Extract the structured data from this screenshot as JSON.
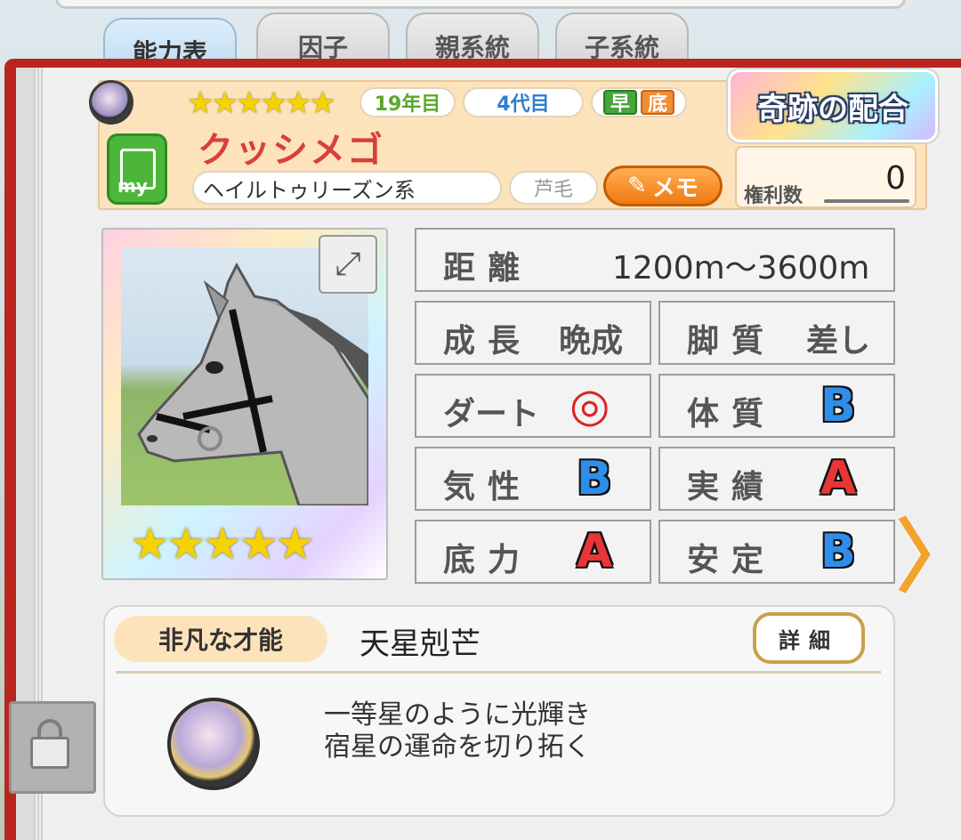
{
  "tabs": [
    "能力表",
    "因子",
    "親系統",
    "子系統"
  ],
  "header": {
    "star_glyphs": "★★★★★★",
    "generation_years": "19年目",
    "generation_count": "4代目",
    "aptitude_early": "早",
    "aptitude_base": "底",
    "horse_name": "クッシメゴ",
    "my_badge": "my",
    "lineage": "ヘイルトゥリーズン系",
    "coat": "芦毛",
    "memo_label": "メモ",
    "miracle_label": "奇跡の配合",
    "rights_label": "権利数",
    "rights_value": "0"
  },
  "portrait": {
    "star_glyphs": "★★★★★",
    "expand_glyph": "⤢"
  },
  "stats": {
    "distance_label": "距離",
    "distance_value": "1200m〜3600m",
    "growth_label": "成長",
    "growth_value": "晩成",
    "leg_label": "脚質",
    "leg_value": "差し",
    "dirt_label": "ダート",
    "dirt_value": "◎",
    "constitution_label": "体質",
    "constitution_value": "B",
    "temper_label": "気性",
    "temper_value": "B",
    "record_label": "実績",
    "record_value": "A",
    "stamina_label": "底力",
    "stamina_value": "A",
    "stability_label": "安定",
    "stability_value": "B"
  },
  "talent": {
    "tag": "非凡な才能",
    "name": "天星剋芒",
    "detail_label": "詳細",
    "desc_line1": "一等星のように光輝き",
    "desc_line2": "宿星の運命を切り拓く"
  },
  "nav": {
    "next_glyph": "〉"
  }
}
